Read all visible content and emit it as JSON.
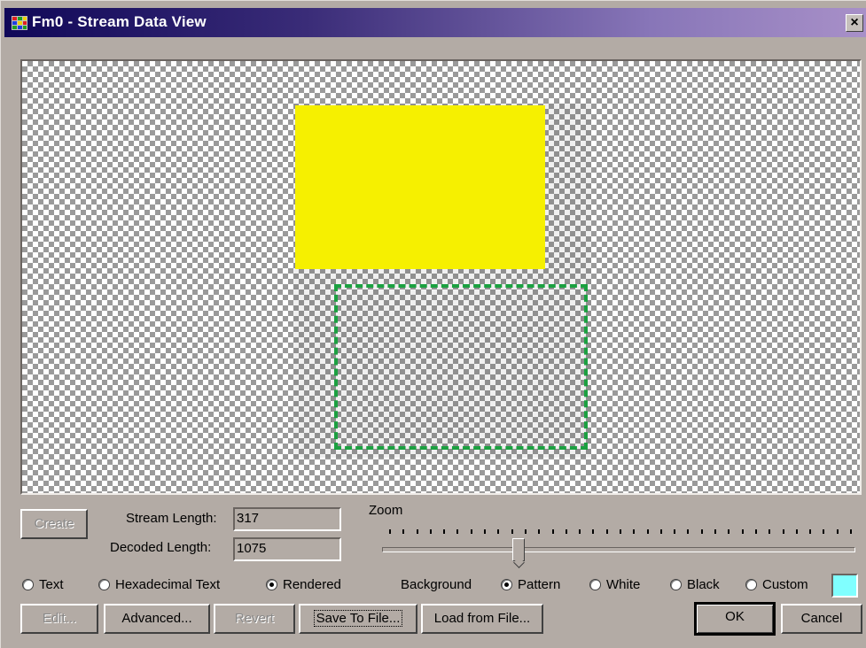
{
  "window": {
    "title": "Fm0 - Stream Data View",
    "close_label": "×"
  },
  "colors": {
    "titlebar_start": "#100858",
    "titlebar_end": "#a890c8",
    "yellow_fill": "#f6f000",
    "dashed_green": "#1ba040",
    "custom_swatch": "#80ffff"
  },
  "controls": {
    "create_label": "Create",
    "stream_length_label": "Stream Length:",
    "stream_length_value": "317",
    "decoded_length_label": "Decoded Length:",
    "decoded_length_value": "1075",
    "zoom_label": "Zoom",
    "zoom_level": 0.29
  },
  "view_mode": {
    "options": [
      "Text",
      "Hexadecimal Text",
      "Rendered"
    ],
    "selected": "Rendered"
  },
  "background": {
    "label": "Background",
    "options": [
      "Pattern",
      "White",
      "Black",
      "Custom"
    ],
    "selected": "Pattern"
  },
  "buttons": {
    "edit": "Edit...",
    "advanced": "Advanced...",
    "revert": "Revert",
    "save_to_file": "Save To File...",
    "load_from_file": "Load from File...",
    "ok": "OK",
    "cancel": "Cancel"
  }
}
